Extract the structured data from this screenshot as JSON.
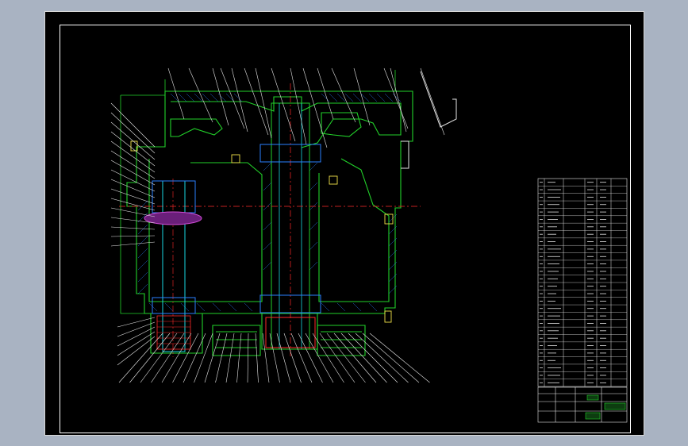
{
  "drawing": {
    "colors": {
      "background": "#000000",
      "frame": "#ffffff",
      "outline_green": "#22d12a",
      "hatch_blue": "#2a7fff",
      "center_red": "#ff2a2a",
      "leader_white": "#e6e6e6",
      "detail_cyan": "#19d6e0",
      "spring_magenta": "#d04bd6",
      "yellow_bolt": "#f2e34a"
    },
    "title_block": {
      "stamp_text": "",
      "drawing_number": "",
      "part_name": ""
    },
    "parts_list": {
      "rows": 28
    }
  }
}
